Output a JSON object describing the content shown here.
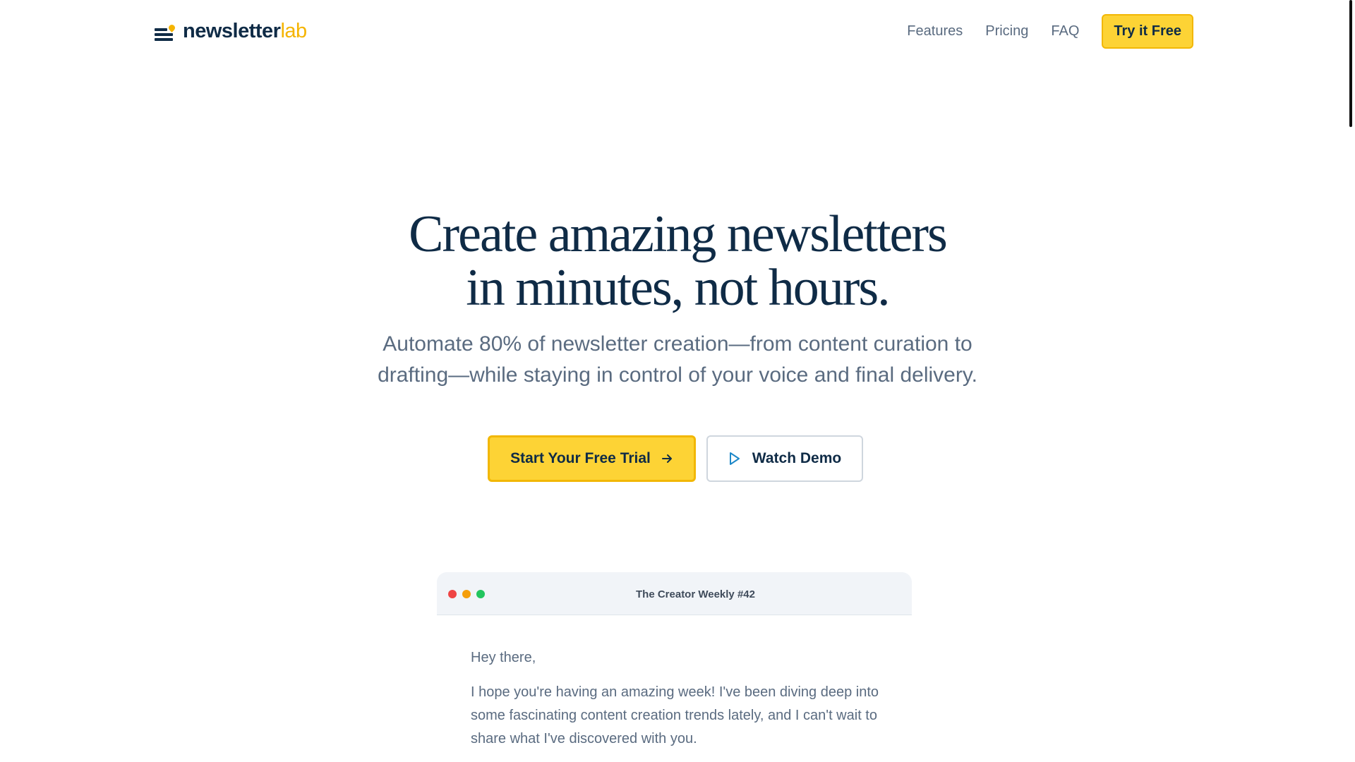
{
  "nav": {
    "logo": {
      "part1": "newsletter",
      "part2": "lab"
    },
    "links": [
      {
        "label": "Features"
      },
      {
        "label": "Pricing"
      },
      {
        "label": "FAQ"
      }
    ],
    "cta_label": "Try it Free"
  },
  "hero": {
    "title_line1": "Create amazing newsletters",
    "title_line2": "in minutes, not hours.",
    "subtitle": "Automate 80% of newsletter creation—from content curation to drafting—while staying in control of your voice and final delivery.",
    "primary_button": "Start Your Free Trial",
    "secondary_button": "Watch Demo"
  },
  "preview": {
    "title": "The Creator Weekly #42",
    "greeting": "Hey there,",
    "body": "I hope you're having an amazing week! I've been diving deep into some fascinating content creation trends lately, and I can't wait to share what I've discovered with you."
  },
  "colors": {
    "brand_navy": "#0f2b46",
    "brand_yellow": "#fdd335",
    "accent_yellow": "#f5b400",
    "muted_text": "#5a6b80",
    "play_icon": "#1e88c8"
  }
}
